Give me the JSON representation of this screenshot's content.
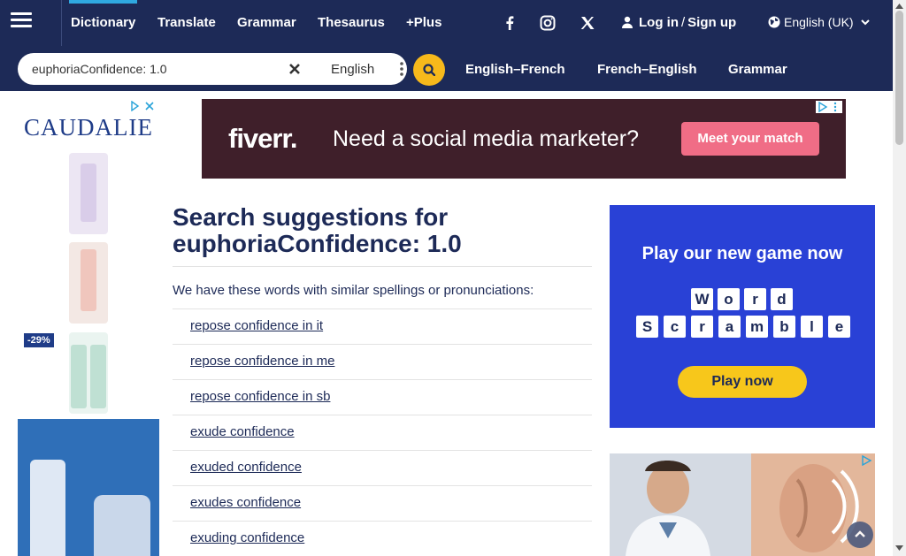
{
  "nav": {
    "links": [
      {
        "label": "Dictionary"
      },
      {
        "label": "Translate"
      },
      {
        "label": "Grammar"
      },
      {
        "label": "Thesaurus"
      },
      {
        "label": "+Plus"
      }
    ],
    "social": [
      "facebook-icon",
      "instagram-icon",
      "x-icon"
    ],
    "login_label": "Log in",
    "separator": "/",
    "signup_label": "Sign up",
    "language_label": "English (UK)"
  },
  "search": {
    "value": "euphoriaConfidence: 1.0",
    "dictionary_select": "English",
    "dict_links": [
      {
        "label": "English–French"
      },
      {
        "label": "French–English"
      },
      {
        "label": "Grammar"
      }
    ]
  },
  "ads": {
    "caudalie_brand": "CAUDALIE",
    "caudalie_discount": "-29%",
    "fiverr_logo": "fiverr.",
    "fiverr_message": "Need a social media marketer?",
    "fiverr_cta": "Meet your match",
    "game_title": "Play our new game now",
    "game_cta": "Play now",
    "word_letters": [
      "W",
      "o",
      "r",
      "d"
    ],
    "scramble_letters": [
      "S",
      "c",
      "r",
      "a",
      "m",
      "b",
      "l",
      "e"
    ]
  },
  "main": {
    "title_prefix": "Search suggestions for",
    "title_query": "euphoriaConfidence: 1.0",
    "intro": "We have these words with similar spellings or pronunciations:",
    "suggestions": [
      "repose confidence in it",
      "repose confidence in me",
      "repose confidence in sb",
      "exude confidence",
      "exuded confidence",
      "exudes confidence",
      "exuding confidence"
    ]
  },
  "colors": {
    "nav_bg": "#1d2a57",
    "accent_yellow": "#f7b91b",
    "fiverr_bg": "#3f1f2a",
    "fiverr_cta": "#f06d86",
    "game_bg": "#2941d6"
  }
}
